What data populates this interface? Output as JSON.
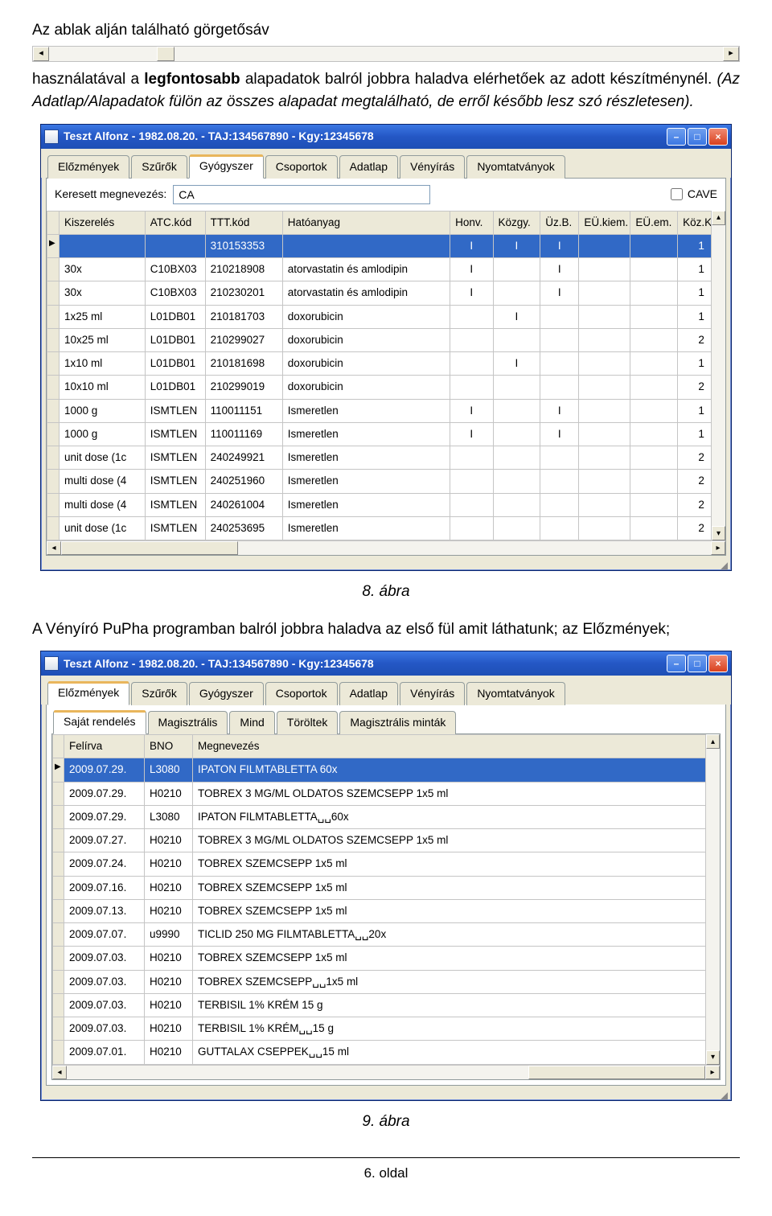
{
  "doc": {
    "p1": "Az ablak alján található görgetősáv",
    "p2a": "használatával a ",
    "p2b_strong": "legfontosabb",
    "p2c": " alapadatok balról jobbra haladva elérhetőek az adott készítménynél. ",
    "p2d_italic": "(Az Adatlap/Alapadatok fülön az összes alapadat megtalálható, de erről később lesz szó részletesen).",
    "caption1": "8. ábra",
    "p3": "A Vényíró PuPha programban balról jobbra haladva az első fül amit láthatunk; az Előzmények;",
    "caption2": "9. ábra",
    "footer": "6. oldal"
  },
  "win1": {
    "title": "Teszt Alfonz - 1982.08.20. - TAJ:134567890 - Kgy:12345678",
    "tabs": [
      "Előzmények",
      "Szűrők",
      "Gyógyszer",
      "Csoportok",
      "Adatlap",
      "Vényírás",
      "Nyomtatványok"
    ],
    "active_tab": 2,
    "search_label": "Keresett megnevezés:",
    "search_value": "CA",
    "cave_label": "CAVE",
    "headers": [
      "Kiszerelés",
      "ATC.kód",
      "TTT.kód",
      "Hatóanyag",
      "Honv.",
      "Közgy.",
      "Üz.B.",
      "EÜ.kiem.",
      "EÜ.em.",
      "Köz.Ker"
    ],
    "rows": [
      {
        "sel": true,
        "c": [
          "",
          "",
          "310153353",
          "",
          "I",
          "I",
          "I",
          "",
          "",
          "1"
        ]
      },
      {
        "sel": false,
        "c": [
          "30x",
          "C10BX03",
          "210218908",
          "atorvastatin és amlodipin",
          "I",
          "",
          "I",
          "",
          "",
          "1"
        ]
      },
      {
        "sel": false,
        "c": [
          "30x",
          "C10BX03",
          "210230201",
          "atorvastatin és amlodipin",
          "I",
          "",
          "I",
          "",
          "",
          "1"
        ]
      },
      {
        "sel": false,
        "c": [
          "1x25 ml",
          "L01DB01",
          "210181703",
          "doxorubicin",
          "",
          "I",
          "",
          "",
          "",
          "1"
        ]
      },
      {
        "sel": false,
        "c": [
          "10x25 ml",
          "L01DB01",
          "210299027",
          "doxorubicin",
          "",
          "",
          "",
          "",
          "",
          "2"
        ]
      },
      {
        "sel": false,
        "c": [
          "1x10 ml",
          "L01DB01",
          "210181698",
          "doxorubicin",
          "",
          "I",
          "",
          "",
          "",
          "1"
        ]
      },
      {
        "sel": false,
        "c": [
          "10x10 ml",
          "L01DB01",
          "210299019",
          "doxorubicin",
          "",
          "",
          "",
          "",
          "",
          "2"
        ]
      },
      {
        "sel": false,
        "c": [
          "1000 g",
          "ISMTLEN",
          "110011151",
          "Ismeretlen",
          "I",
          "",
          "I",
          "",
          "",
          "1"
        ]
      },
      {
        "sel": false,
        "c": [
          "1000 g",
          "ISMTLEN",
          "110011169",
          "Ismeretlen",
          "I",
          "",
          "I",
          "",
          "",
          "1"
        ]
      },
      {
        "sel": false,
        "c": [
          "unit dose (1c",
          "ISMTLEN",
          "240249921",
          "Ismeretlen",
          "",
          "",
          "",
          "",
          "",
          "2"
        ]
      },
      {
        "sel": false,
        "c": [
          "multi dose (4",
          "ISMTLEN",
          "240251960",
          "Ismeretlen",
          "",
          "",
          "",
          "",
          "",
          "2"
        ]
      },
      {
        "sel": false,
        "c": [
          "multi dose (4",
          "ISMTLEN",
          "240261004",
          "Ismeretlen",
          "",
          "",
          "",
          "",
          "",
          "2"
        ]
      },
      {
        "sel": false,
        "c": [
          "unit dose (1c",
          "ISMTLEN",
          "240253695",
          "Ismeretlen",
          "",
          "",
          "",
          "",
          "",
          "2"
        ]
      }
    ]
  },
  "win2": {
    "title": "Teszt Alfonz - 1982.08.20. - TAJ:134567890 - Kgy:12345678",
    "tabs": [
      "Előzmények",
      "Szűrők",
      "Gyógyszer",
      "Csoportok",
      "Adatlap",
      "Vényírás",
      "Nyomtatványok"
    ],
    "active_tab": 0,
    "subtabs": [
      "Saját rendelés",
      "Magisztrális",
      "Mind",
      "Töröltek",
      "Magisztrális minták"
    ],
    "active_subtab": 0,
    "headers": [
      "Felírva",
      "BNO",
      "Megnevezés"
    ],
    "rows": [
      {
        "sel": true,
        "c": [
          "2009.07.29.",
          "L3080",
          "IPATON FILMTABLETTA 60x"
        ]
      },
      {
        "sel": false,
        "c": [
          "2009.07.29.",
          "H0210",
          "TOBREX 3 MG/ML OLDATOS SZEMCSEPP 1x5 ml"
        ]
      },
      {
        "sel": false,
        "c": [
          "2009.07.29.",
          "L3080",
          "IPATON FILMTABLETTA␣␣60x"
        ]
      },
      {
        "sel": false,
        "c": [
          "2009.07.27.",
          "H0210",
          "TOBREX 3 MG/ML OLDATOS SZEMCSEPP 1x5 ml"
        ]
      },
      {
        "sel": false,
        "c": [
          "2009.07.24.",
          "H0210",
          "TOBREX SZEMCSEPP 1x5 ml"
        ]
      },
      {
        "sel": false,
        "c": [
          "2009.07.16.",
          "H0210",
          "TOBREX SZEMCSEPP 1x5 ml"
        ]
      },
      {
        "sel": false,
        "c": [
          "2009.07.13.",
          "H0210",
          "TOBREX SZEMCSEPP 1x5 ml"
        ]
      },
      {
        "sel": false,
        "c": [
          "2009.07.07.",
          "u9990",
          "TICLID 250 MG FILMTABLETTA␣␣20x"
        ]
      },
      {
        "sel": false,
        "c": [
          "2009.07.03.",
          "H0210",
          "TOBREX SZEMCSEPP 1x5 ml"
        ]
      },
      {
        "sel": false,
        "c": [
          "2009.07.03.",
          "H0210",
          "TOBREX SZEMCSEPP␣␣1x5 ml"
        ]
      },
      {
        "sel": false,
        "c": [
          "2009.07.03.",
          "H0210",
          "TERBISIL 1% KRÉM 15 g"
        ]
      },
      {
        "sel": false,
        "c": [
          "2009.07.03.",
          "H0210",
          "TERBISIL 1% KRÉM␣␣15 g"
        ]
      },
      {
        "sel": false,
        "c": [
          "2009.07.01.",
          "H0210",
          "GUTTALAX CSEPPEK␣␣15 ml"
        ]
      }
    ]
  }
}
